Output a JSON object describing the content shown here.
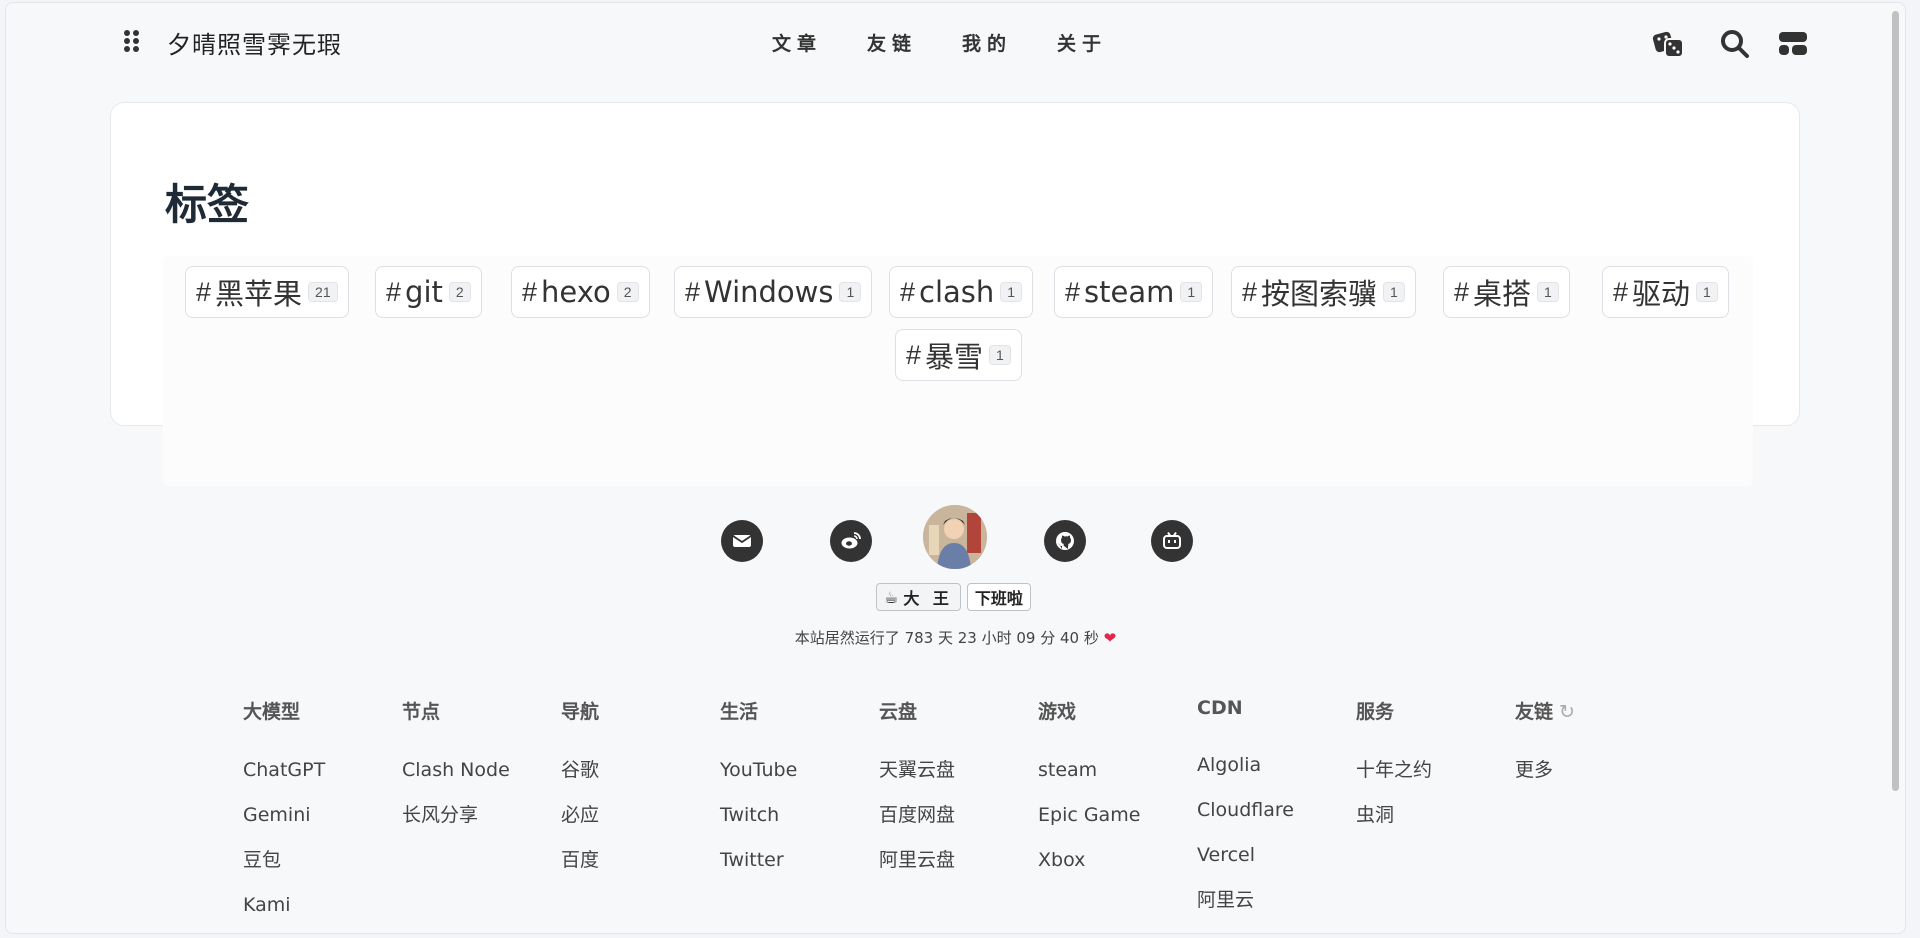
{
  "header": {
    "site_title": "夕晴照雪霁无瑕",
    "nav": [
      "文章",
      "友链",
      "我的",
      "关于"
    ]
  },
  "card": {
    "title": "标签",
    "tags": [
      {
        "name": "黑苹果",
        "count": "21"
      },
      {
        "name": "git",
        "count": "2"
      },
      {
        "name": "hexo",
        "count": "2"
      },
      {
        "name": "Windows",
        "count": "1"
      },
      {
        "name": "clash",
        "count": "1"
      },
      {
        "name": "steam",
        "count": "1"
      },
      {
        "name": "按图索骥",
        "count": "1"
      },
      {
        "name": "桌搭",
        "count": "1"
      },
      {
        "name": "驱动",
        "count": "1"
      },
      {
        "name": "暴雪",
        "count": "1"
      }
    ]
  },
  "footer": {
    "badge_left": "大 王",
    "badge_right": "下班啦",
    "runtime": "本站居然运行了 783 天 23 小时 09 分 40 秒",
    "columns": [
      {
        "title": "大模型",
        "links": [
          "ChatGPT",
          "Gemini",
          "豆包",
          "Kami"
        ]
      },
      {
        "title": "节点",
        "links": [
          "Clash Node",
          "长风分享"
        ]
      },
      {
        "title": "导航",
        "links": [
          "谷歌",
          "必应",
          "百度"
        ]
      },
      {
        "title": "生活",
        "links": [
          "YouTube",
          "Twitch",
          "Twitter"
        ]
      },
      {
        "title": "云盘",
        "links": [
          "天翼云盘",
          "百度网盘",
          "阿里云盘"
        ]
      },
      {
        "title": "游戏",
        "links": [
          "steam",
          "Epic Game",
          "Xbox"
        ]
      },
      {
        "title": "CDN",
        "links": [
          "Algolia",
          "Cloudflare",
          "Vercel",
          "阿里云"
        ]
      },
      {
        "title": "服务",
        "links": [
          "十年之约",
          "虫洞"
        ]
      },
      {
        "title": "友链",
        "links": [
          "更多"
        ]
      }
    ]
  },
  "colors": {
    "accent": "#333333",
    "heart": "#e0284a",
    "card_bg": "#ffffff"
  }
}
